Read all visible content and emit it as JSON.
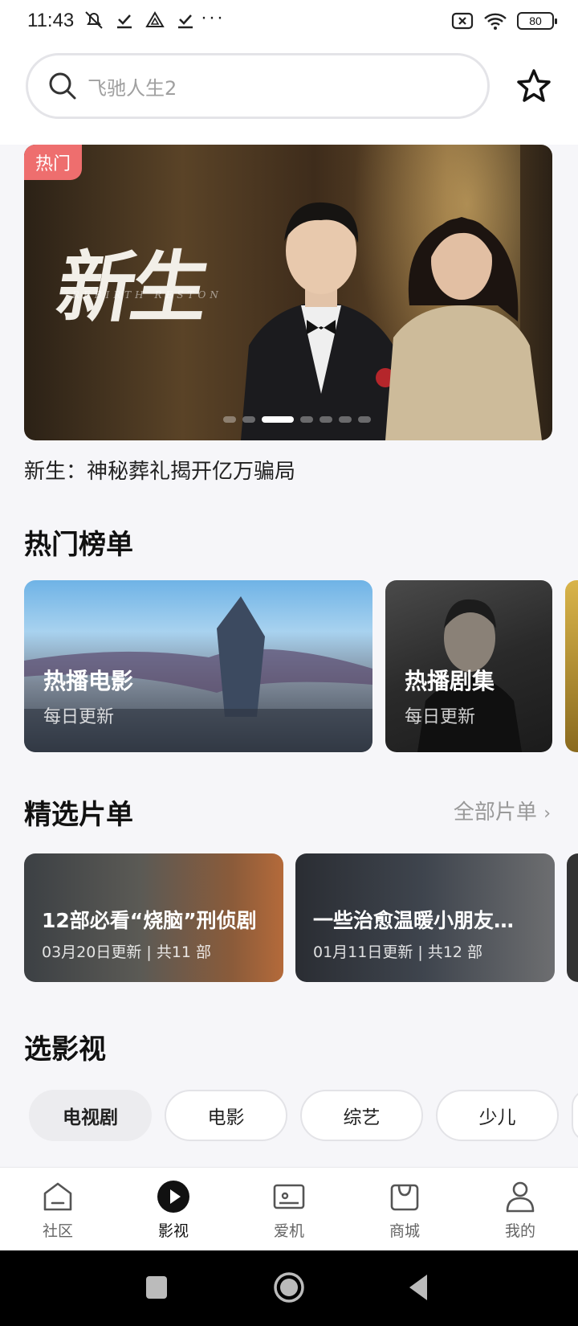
{
  "status_bar": {
    "time": "11:43",
    "battery": "80",
    "more": "···"
  },
  "search": {
    "placeholder": "飞驰人生2"
  },
  "banner": {
    "badge": "热门",
    "art_title": "新生",
    "art_subtitle": "REBIRTH RESTON",
    "caption": "新生：神秘葬礼揭开亿万骗局",
    "page_count": 7,
    "active_page": 3
  },
  "hot_list": {
    "title": "热门榜单",
    "cards": [
      {
        "title": "热播电影",
        "subtitle": "每日更新"
      },
      {
        "title": "热播剧集",
        "subtitle": "每日更新"
      }
    ]
  },
  "playlists": {
    "title": "精选片单",
    "more": "全部片单",
    "cards": [
      {
        "title": "12部必看“烧脑”刑侦剧",
        "meta": "03月20日更新 | 共11 部"
      },
      {
        "title": "一些治愈温暖小朋友…",
        "meta": "01月11日更新 | 共12 部"
      }
    ]
  },
  "categories": {
    "title": "选影视",
    "chips": [
      "电视剧",
      "电影",
      "综艺",
      "少儿"
    ],
    "selected": "电视剧"
  },
  "bottom_nav": {
    "items": [
      {
        "label": "社区",
        "icon": "home-icon"
      },
      {
        "label": "影视",
        "icon": "play-icon"
      },
      {
        "label": "爱机",
        "icon": "device-icon"
      },
      {
        "label": "商城",
        "icon": "bag-icon"
      },
      {
        "label": "我的",
        "icon": "person-icon"
      }
    ],
    "active": "影视"
  },
  "colors": {
    "hot_badge": "#ee6e6e",
    "background": "#f6f6f9",
    "text_primary": "#111111",
    "text_secondary": "#999999"
  }
}
